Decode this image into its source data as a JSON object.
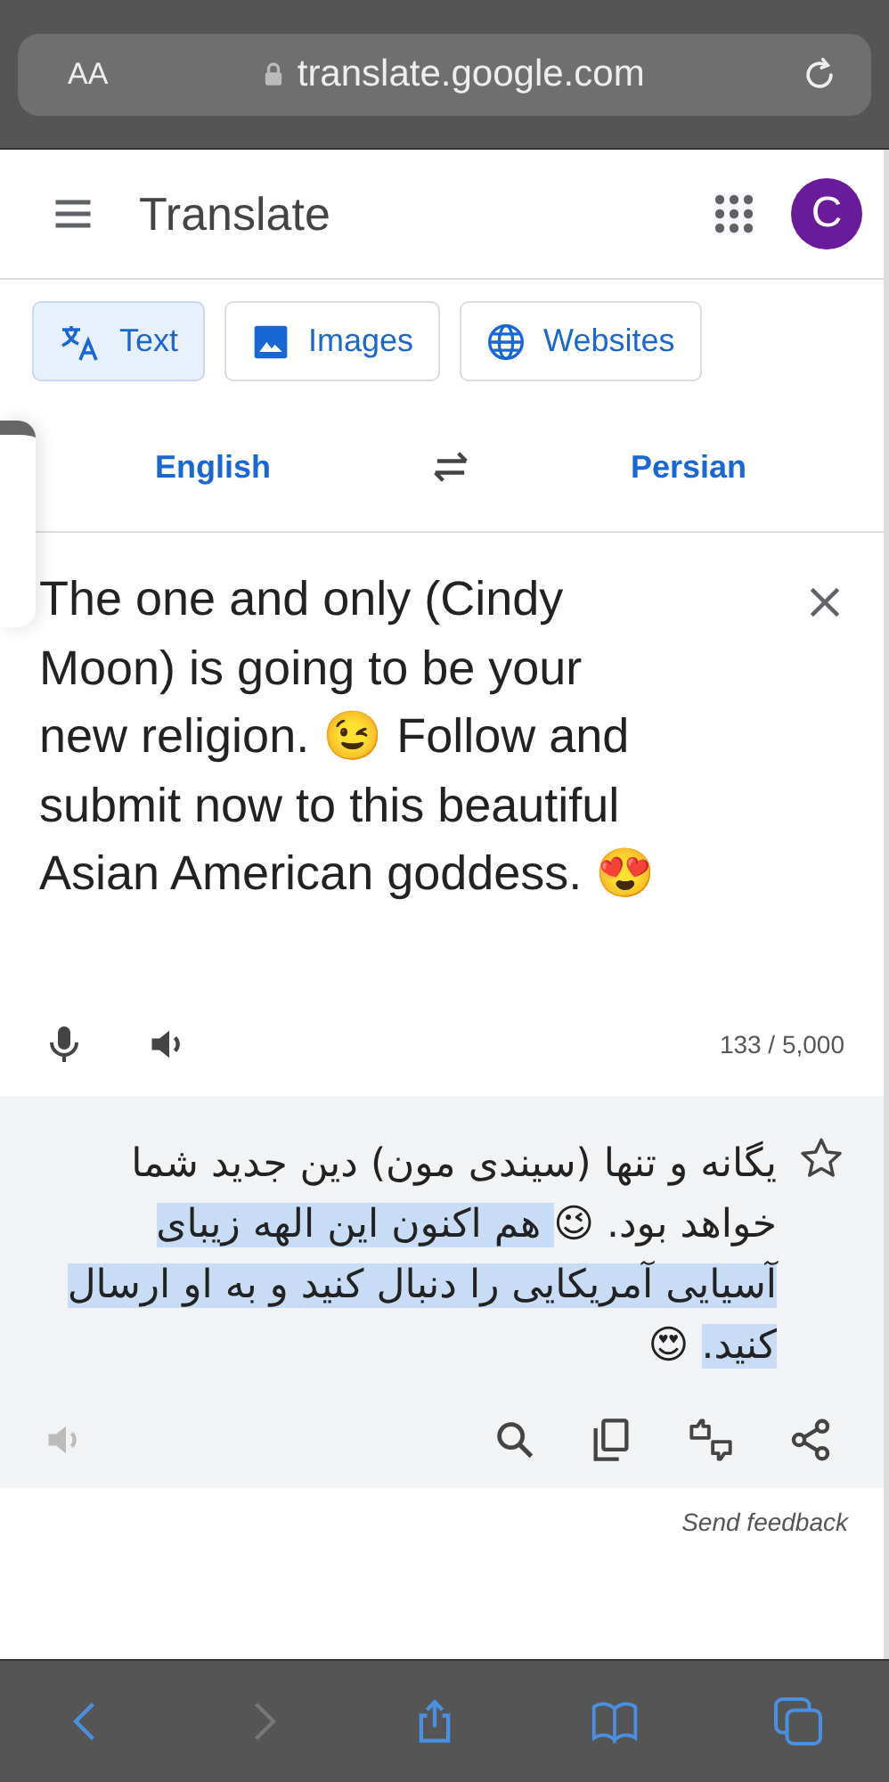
{
  "browser": {
    "text_size_button": "AA",
    "url": "translate.google.com"
  },
  "header": {
    "title": "Translate",
    "avatar": "C"
  },
  "modes": [
    {
      "label": "Text",
      "kind": "translate",
      "selected": true
    },
    {
      "label": "Images",
      "kind": "image",
      "selected": false
    },
    {
      "label": "Websites",
      "kind": "globe",
      "selected": false
    }
  ],
  "languages": {
    "source": "English",
    "target": "Persian"
  },
  "input": {
    "text": "The one and only (Cindy Moon) is going to be your new religion. 😉 Follow and submit now to this beautiful Asian American goddess. 😍",
    "count": "133 / 5,000"
  },
  "output": {
    "starred": false,
    "segments": [
      {
        "text": "یگانه و تنها (سیندی مون) دین جدید شما خواهد بود. 😉",
        "selected": false
      },
      {
        "text": " هم اکنون این الهه زیبای آسیایی آمریکایی را دنبال کنید و به او ارسال کنید.",
        "selected": true
      },
      {
        "text": " 😍",
        "selected": false
      }
    ]
  },
  "feedback": "Send feedback"
}
